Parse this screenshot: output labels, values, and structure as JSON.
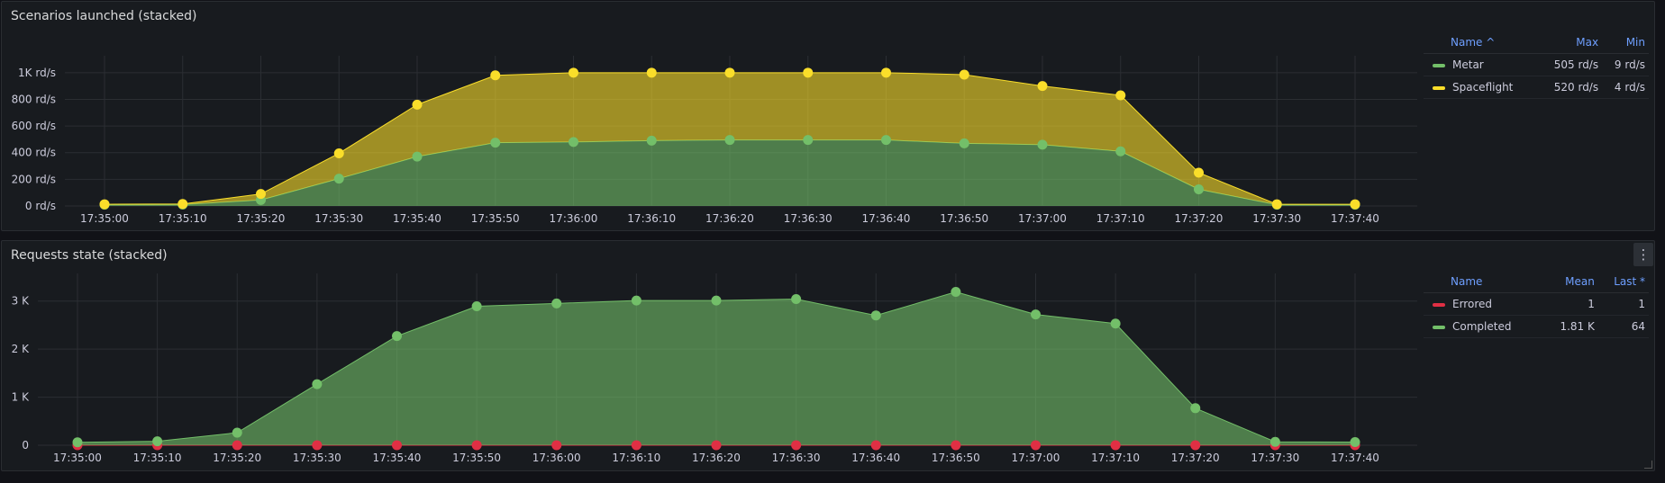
{
  "panels": [
    {
      "title": "Scenarios launched (stacked)",
      "legend": {
        "columns": [
          "Name ^",
          "Max",
          "Min"
        ],
        "rows": [
          {
            "name": "Metar",
            "color": "#73bf69",
            "values": [
              "505 rd/s",
              "9 rd/s"
            ]
          },
          {
            "name": "Spaceflight",
            "color": "#fade2a",
            "values": [
              "520 rd/s",
              "4 rd/s"
            ]
          }
        ]
      },
      "chart_data": {
        "type": "area",
        "stacked": true,
        "x": [
          "17:35:00",
          "17:35:10",
          "17:35:20",
          "17:35:30",
          "17:35:40",
          "17:35:50",
          "17:36:00",
          "17:36:10",
          "17:36:20",
          "17:36:30",
          "17:36:40",
          "17:36:50",
          "17:37:00",
          "17:37:10",
          "17:37:20",
          "17:37:30",
          "17:37:40"
        ],
        "y_ticks": [
          "0 rd/s",
          "200 rd/s",
          "400 rd/s",
          "600 rd/s",
          "800 rd/s",
          "1K rd/s"
        ],
        "ylim": [
          0,
          1100
        ],
        "series": [
          {
            "name": "Metar",
            "color": "#73bf69",
            "values": [
              9,
              10,
              45,
              205,
              370,
              475,
              480,
              490,
              495,
              495,
              495,
              470,
              460,
              410,
              125,
              9,
              9
            ]
          },
          {
            "name": "Spaceflight",
            "color": "#fade2a",
            "values": [
              4,
              5,
              45,
              190,
              390,
              505,
              520,
              510,
              505,
              505,
              505,
              515,
              440,
              420,
              125,
              4,
              4
            ]
          }
        ]
      }
    },
    {
      "title": "Requests state (stacked)",
      "legend": {
        "columns": [
          "Name",
          "Mean",
          "Last *"
        ],
        "rows": [
          {
            "name": "Errored",
            "color": "#e02f44",
            "values": [
              "1",
              "1"
            ]
          },
          {
            "name": "Completed",
            "color": "#73bf69",
            "values": [
              "1.81 K",
              "64"
            ]
          }
        ]
      },
      "chart_data": {
        "type": "area",
        "stacked": true,
        "x": [
          "17:35:00",
          "17:35:10",
          "17:35:20",
          "17:35:30",
          "17:35:40",
          "17:35:50",
          "17:36:00",
          "17:36:10",
          "17:36:20",
          "17:36:30",
          "17:36:40",
          "17:36:50",
          "17:37:00",
          "17:37:10",
          "17:37:20",
          "17:37:30",
          "17:37:40"
        ],
        "y_ticks": [
          "0",
          "1 K",
          "2 K",
          "3 K"
        ],
        "ylim": [
          0,
          3500
        ],
        "series": [
          {
            "name": "Errored",
            "color": "#e02f44",
            "values": [
              1,
              1,
              1,
              1,
              1,
              1,
              1,
              1,
              1,
              1,
              1,
              1,
              1,
              1,
              1,
              1,
              1
            ]
          },
          {
            "name": "Completed",
            "color": "#73bf69",
            "values": [
              60,
              80,
              260,
              1270,
              2270,
              2890,
              2950,
              3010,
              3010,
              3040,
              2700,
              3190,
              2720,
              2530,
              770,
              70,
              64
            ]
          }
        ]
      }
    }
  ],
  "icons": {
    "panel_menu": "vertical-ellipsis-icon"
  },
  "menu_glyph": "⋮"
}
